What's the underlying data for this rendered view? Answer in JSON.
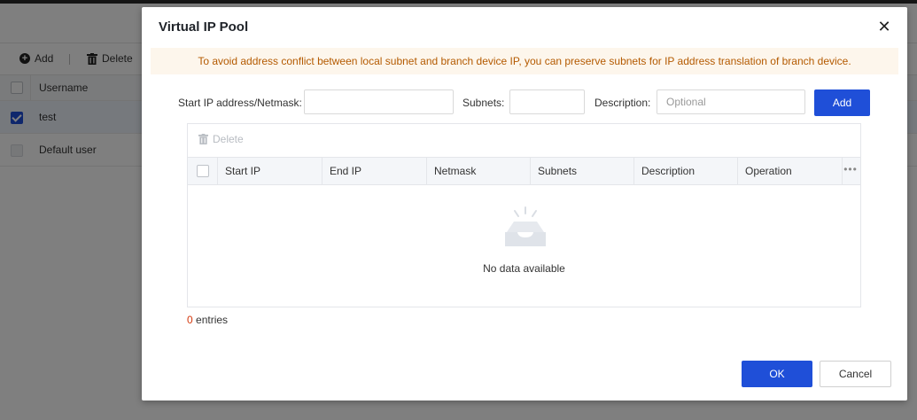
{
  "background": {
    "toolbar": {
      "add_label": "Add",
      "delete_label": "Delete"
    },
    "table": {
      "header": "Username",
      "rows": [
        {
          "name": "test",
          "checked": true
        },
        {
          "name": "Default user",
          "checked": false,
          "disabled": true
        }
      ]
    }
  },
  "modal": {
    "title": "Virtual IP Pool",
    "close_icon": "close-icon",
    "notice": "To avoid address conflict between local subnet and branch device IP, you can preserve subnets for IP address translation of branch device.",
    "form": {
      "start_ip_label": "Start IP address/Netmask:",
      "start_ip_value": "",
      "subnets_label": "Subnets:",
      "subnets_value": "",
      "description_label": "Description:",
      "description_placeholder": "Optional",
      "add_label": "Add"
    },
    "grid": {
      "delete_label": "Delete",
      "columns": [
        "Start IP",
        "End IP",
        "Netmask",
        "Subnets",
        "Description",
        "Operation"
      ],
      "more_icon": "ellipsis-icon",
      "empty_text": "No data available"
    },
    "entries": {
      "count": "0",
      "label": " entries"
    },
    "footer": {
      "ok_label": "OK",
      "cancel_label": "Cancel"
    }
  },
  "colors": {
    "primary": "#1f4fd8",
    "notice_bg": "#fdf6ec",
    "notice_text": "#b45a00",
    "count_text": "#d4380d"
  }
}
